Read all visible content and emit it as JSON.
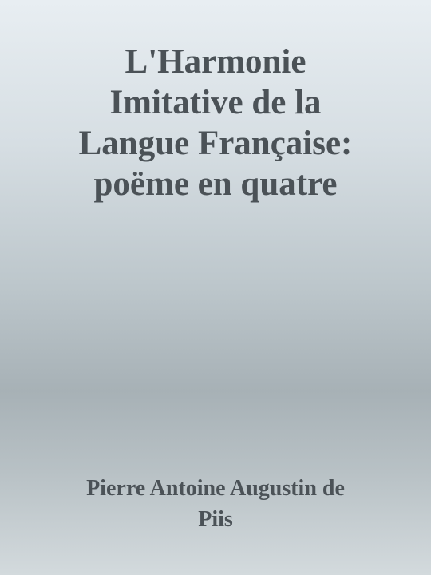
{
  "cover": {
    "title_lines": [
      "L'Harmonie",
      "Imitative de la",
      "Langue Française:",
      "poëme en quatre"
    ],
    "author_lines": [
      "Pierre Antoine Augustin de",
      "Piis"
    ],
    "colors": {
      "text": "#4b5257",
      "background_top": "#e8eef2",
      "background_middle": "#a7b1b6",
      "background_bottom": "#d3dadd"
    }
  }
}
